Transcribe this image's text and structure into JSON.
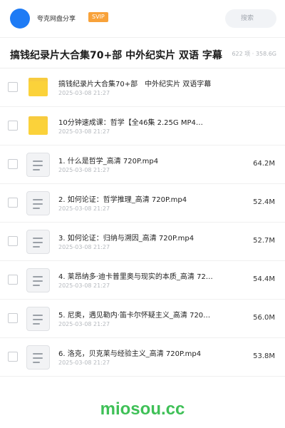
{
  "header": {
    "brand": "夸克网盘分享",
    "badge": "SVIP",
    "search_placeholder": "搜索",
    "accent_color": "#1e7bf5"
  },
  "share": {
    "title": "搞钱纪录片大合集70+部 中外纪实片 双语 字幕",
    "stats": "622 项 · 358.6G"
  },
  "items": [
    {
      "type": "folder",
      "icon": "folder-icon",
      "name": "搞钱纪录片大合集70+部　中外纪实片 双语字幕",
      "date": "2025-03-08 21:27",
      "size": ""
    },
    {
      "type": "folder",
      "icon": "folder-icon",
      "name": "10分钟速成课：哲学【全46集 2.25G MP4…",
      "date": "2025-03-08 21:27",
      "size": ""
    },
    {
      "type": "file",
      "icon": "file-icon",
      "name": "1. 什么是哲学_高清 720P.mp4",
      "date": "2025-03-08 21:27",
      "size": "64.2M"
    },
    {
      "type": "file",
      "icon": "file-icon",
      "name": "2. 如何论证：哲学推理_高清 720P.mp4",
      "date": "2025-03-08 21:27",
      "size": "52.4M"
    },
    {
      "type": "file",
      "icon": "file-icon",
      "name": "3. 如何论证：归纳与溯因_高清 720P.mp4",
      "date": "2025-03-08 21:27",
      "size": "52.7M"
    },
    {
      "type": "file",
      "icon": "file-icon",
      "name": "4. 莱昂纳多·迪卡普里奥与现实的本质_高清 72…",
      "date": "2025-03-08 21:27",
      "size": "54.4M"
    },
    {
      "type": "file",
      "icon": "file-icon",
      "name": "5. 尼奥，遇见勒内·笛卡尔怀疑主义_高清 720…",
      "date": "2025-03-08 21:27",
      "size": "56.0M"
    },
    {
      "type": "file",
      "icon": "file-icon",
      "name": "6. 洛克，贝克莱与经验主义_高清 720P.mp4",
      "date": "2025-03-08 21:27",
      "size": "53.8M"
    }
  ],
  "watermark": "miosou.cc"
}
